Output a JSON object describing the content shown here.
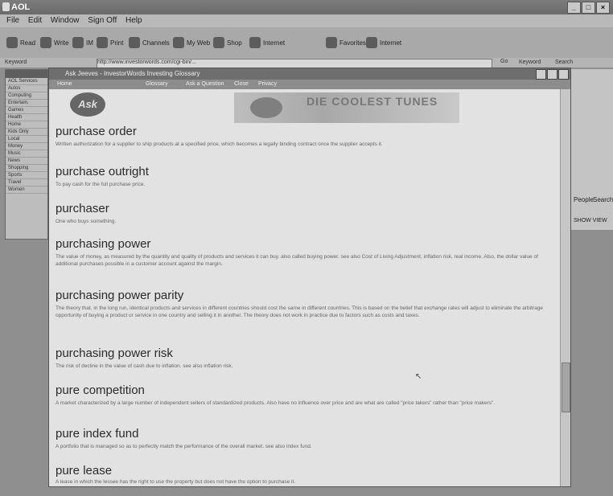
{
  "app": {
    "title": "AOL"
  },
  "menu": [
    "File",
    "Edit",
    "Window",
    "Sign Off",
    "Help"
  ],
  "toolbar": [
    "Read",
    "Write",
    "IM",
    "Print",
    "Channels",
    "My Web",
    "Shop",
    "Internet",
    "Favorites",
    "Internet"
  ],
  "address": {
    "label": "Keyword",
    "value": "http://www.investorwords.com/cgi-bin/...",
    "go": "Go",
    "keyword": "Keyword",
    "search": "Search"
  },
  "inner": {
    "title": "Ask Jeeves - InvestorWords Investing Glossary",
    "nav": [
      "Home",
      "Glossary",
      "Ask a Question",
      "Close",
      "Privacy"
    ]
  },
  "banner": {
    "logo": "Ask",
    "text": "DIE COOLEST TUNES"
  },
  "entries": [
    {
      "term": "purchase order",
      "def": "Written authorization for a supplier to ship products at a specified price, which becomes a legally binding contract once the supplier accepts it."
    },
    {
      "term": "purchase outright",
      "def": "To pay cash for the full purchase price."
    },
    {
      "term": "purchaser",
      "def": "One who buys something."
    },
    {
      "term": "purchasing power",
      "def": "The value of money, as measured by the quantity and quality of products and services it can buy. also called buying power. see also Cost of Living Adjustment, inflation risk, real income. Also, the dollar value of additional purchases possible in a customer account against the margin."
    },
    {
      "term": "purchasing power parity",
      "def": "The theory that, in the long run, identical products and services in different countries should cost the same in different countries. This is based on the belief that exchange rates will adjust to eliminate the arbitrage opportunity of buying a product or service in one country and selling it in another. The theory does not work in practice due to factors such as costs and taxes."
    },
    {
      "term": "purchasing power risk",
      "def": "The risk of decline in the value of cash due to inflation. see also inflation risk."
    },
    {
      "term": "pure competition",
      "def": "A market characterized by a large number of independent sellers of standardized products. Also have no influence over price and are what are called \"price takers\" rather than \"price makers\"."
    },
    {
      "term": "pure index fund",
      "def": "A portfolio that is managed so as to perfectly match the performance of the overall market. see also index fund."
    },
    {
      "term": "pure lease",
      "def": "A lease in which the lessee has the right to use the property but does not have the option to purchase it."
    }
  ],
  "rpanel": {
    "people": "People",
    "search": "Search",
    "show": "SHOW VIEW"
  }
}
